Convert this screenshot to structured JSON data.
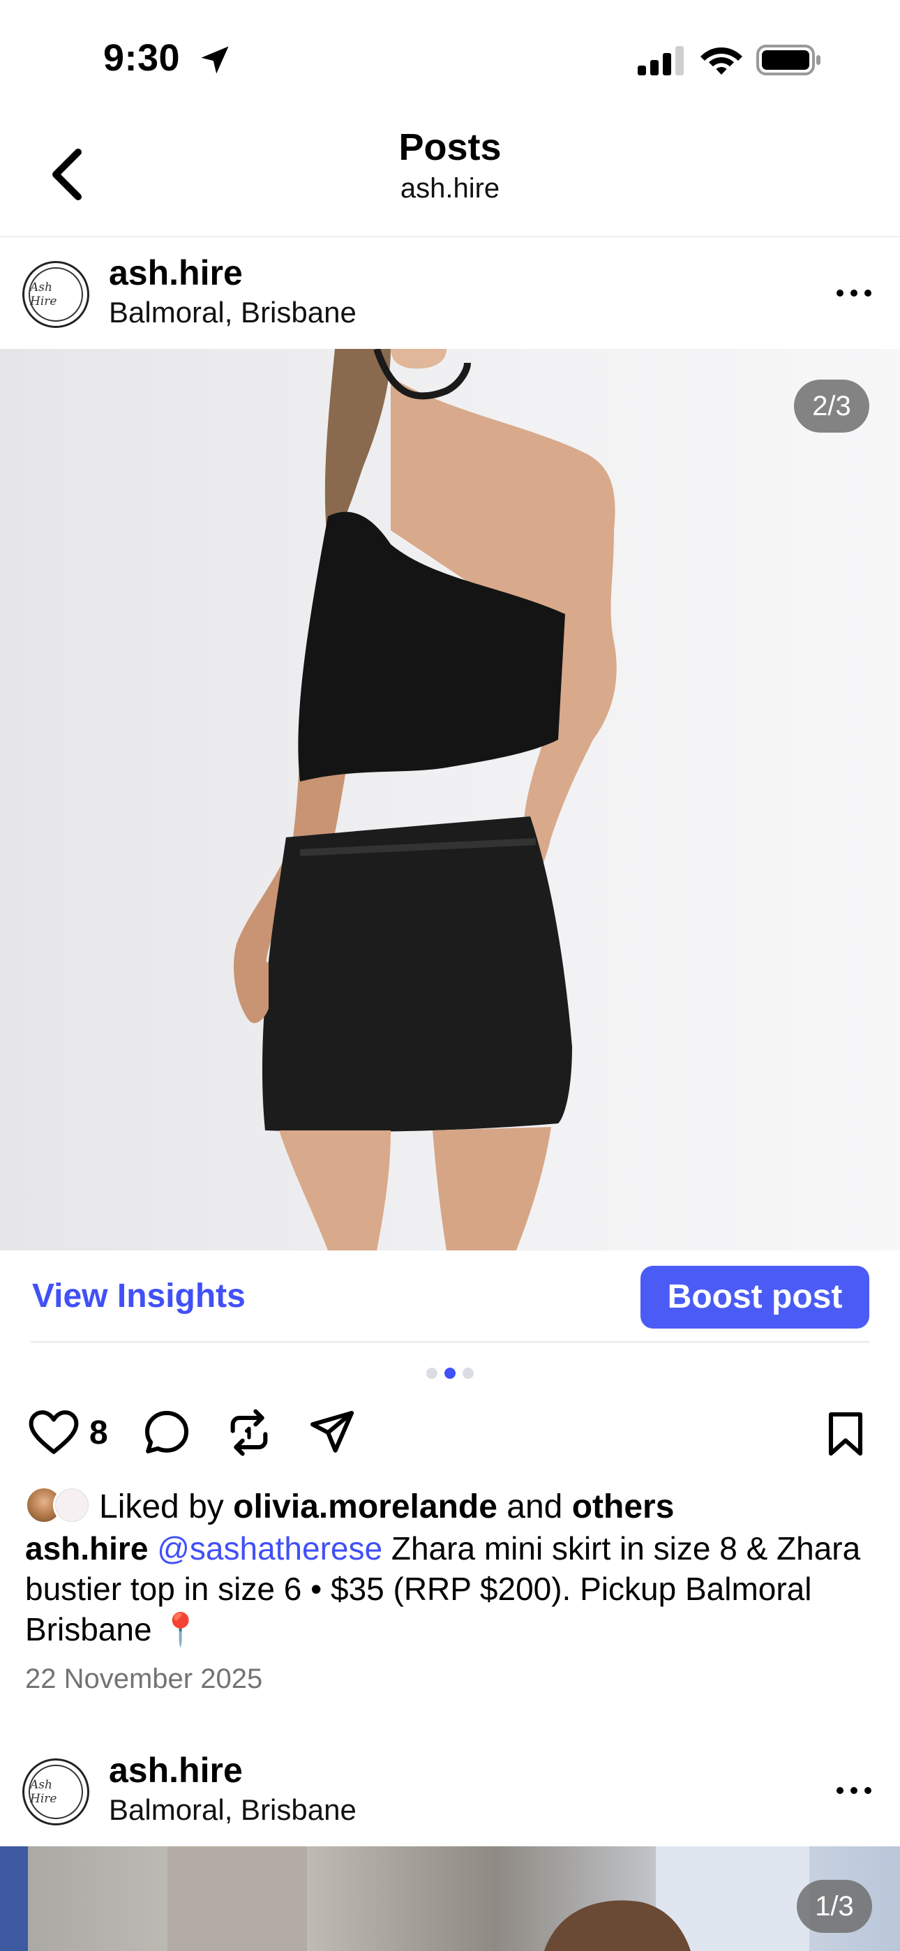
{
  "status_bar": {
    "time": "9:30",
    "icons": [
      "location-arrow-icon",
      "cellular-signal-icon",
      "wifi-icon",
      "battery-icon"
    ]
  },
  "nav": {
    "title": "Posts",
    "subtitle": "ash.hire",
    "back_icon": "chevron-left-icon"
  },
  "posts": [
    {
      "username": "ash.hire",
      "location": "Balmoral, Brisbane",
      "avatar_text": "Ash Hire",
      "page_indicator": "2/3",
      "carousel": {
        "total": 3,
        "active_index": 1
      },
      "view_insights_label": "View Insights",
      "boost_label": "Boost post",
      "like_count": "8",
      "liked_by": {
        "prefix": "Liked by",
        "user": "olivia.morelande",
        "connector": "and",
        "others": "others"
      },
      "caption": {
        "user": "ash.hire",
        "mention": "@sashatherese",
        "text": "Zhara mini skirt in size 8 & Zhara bustier top in size 6 • $35 (RRP $200). Pickup Balmoral Brisbane 📍"
      },
      "date": "22 November 2025"
    },
    {
      "username": "ash.hire",
      "location": "Balmoral, Brisbane",
      "avatar_text": "Ash Hire",
      "page_indicator": "1/3"
    }
  ],
  "colors": {
    "accent": "#4150f7",
    "boost_button": "#4a5cf5",
    "muted_text": "#737373",
    "counter_bg": "#6e6e6e"
  }
}
